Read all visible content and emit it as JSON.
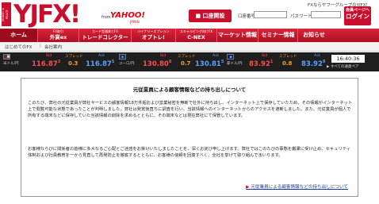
{
  "brand": {
    "badge": "MONEY & PEACE",
    "logo_text": "YJFX!",
    "logo_from": "from",
    "logo_yahoo": "YAHOO!",
    "logo_japan": "JAPAN"
  },
  "header": {
    "fx_link": "FXならヤフーグループのYJFX!",
    "open_account_label": "口座開設",
    "login_id_label": "口座番号",
    "login_pw_label": "パスワード",
    "login_button_top": "会員ページへ",
    "login_button_main": "ログイン"
  },
  "nav": {
    "home": "ホーム",
    "items": [
      {
        "sub": "FX取引",
        "main": "外貨ex"
      },
      {
        "sub": "カード型通貨とFX",
        "main": "トレードコレクター"
      },
      {
        "sub": "バイナリーオプション",
        "main": "オプトレ!"
      },
      {
        "sub": "スキャルピング向けFX",
        "main": "C-NEX"
      }
    ],
    "market": "マーケット情報",
    "seminar": "セミナー情報",
    "news": "お知らせ"
  },
  "subnav": {
    "link1": "はじめてのFX",
    "link2": "会社案内"
  },
  "rates": {
    "colors": {
      "bid": "#ff4d4d",
      "ask": "#5aa0ff",
      "spread": "#f3a21b"
    },
    "pairs": [
      {
        "pair": "米ドル/円",
        "bid_label": "Bid",
        "bid": "116.87",
        "bid_pip": "2",
        "spread_label": "スプレッド",
        "spread": "0.3",
        "ask_label": "Ask",
        "ask": "116.87",
        "ask_pip": "5",
        "flag_icon": "us-flag-icon"
      },
      {
        "pair": "ユーロ/円",
        "bid_label": "Bid",
        "bid": "130.80",
        "bid_pip": "8",
        "spread_label": "スプレッド",
        "spread": "0.7",
        "ask_label": "Ask",
        "ask": "130.81",
        "ask_pip": "5",
        "flag_icon": "eu-flag-icon"
      },
      {
        "pair": "豪ドル/円",
        "bid_label": "Bid",
        "bid": "83.92",
        "bid_pip": "1",
        "spread_label": "スプレッド",
        "spread": "0.8",
        "ask_label": "Ask",
        "ask": "83.92",
        "ask_pip": "9",
        "flag_icon": "au-flag-icon"
      }
    ],
    "time": "16:40:36",
    "all_rates_link": "▶ すべての通貨ペア"
  },
  "notice": {
    "title": "元従業員による顧客情報などの持ち出しについて",
    "paragraph1": "このたび、弊社の元従業員が弊社サービスの顧客情報18万件超および営業秘密を無断で社外に持ち出し、インターネット上で保存していたため、その情報がインターネット上で閲覧可能な状態であったことが判明しました。弊社は発覚後直ちに調査を行い、当該情報へのインターネットからのアクセスを遮断しました。また、元従業員が個人で所有する端末などに保存していた当該情報の削除を求めるとともに、その端末などは現在弊社にて保管しています。",
    "paragraph2": "お客様ならびに関係者の皆様に多大なるご心配とご迷惑をお掛けいたしましたことを、深くお詫び申し上げます。弊社ではこのたびの事態を厳粛に受け止め、セキュリティ体制および社員教育を一から見直して再発防止を徹底するとともに、お客様の信頼を回復すべく、全社を挙げて取り組んでまいります。",
    "link_arrow": "▶",
    "link_text": "元従業員による顧客情報などの持ち出しについて"
  }
}
